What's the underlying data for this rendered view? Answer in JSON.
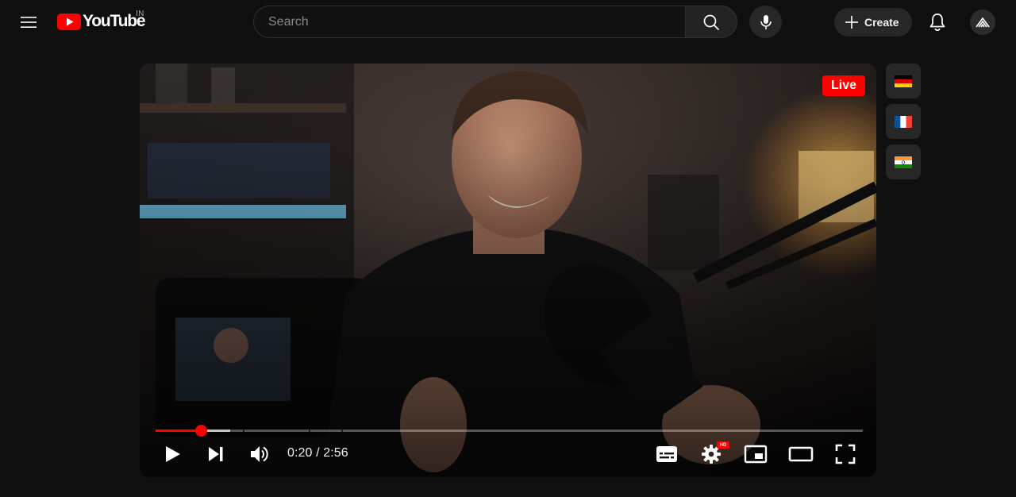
{
  "masthead": {
    "logo_text": "YouTube",
    "region_code": "IN",
    "search": {
      "placeholder": "Search",
      "value": ""
    },
    "create_label": "Create"
  },
  "player": {
    "live_label": "Live",
    "time": {
      "current": "0:20",
      "separator": " / ",
      "duration": "2:56"
    },
    "progress": {
      "played_fraction": 0.064,
      "buffered_fraction": 0.105,
      "chapter_marks": [
        0.123,
        0.217,
        0.263
      ]
    },
    "hd_label": "HD"
  },
  "languages": [
    {
      "icon": "germany-flag-icon",
      "colors": [
        "#000000",
        "#dd0000",
        "#ffce00"
      ]
    },
    {
      "icon": "france-flag-icon",
      "colors": [
        "#0055a4",
        "#ffffff",
        "#ef4135"
      ]
    },
    {
      "icon": "india-flag-icon",
      "colors": [
        "#ff9933",
        "#ffffff",
        "#138808"
      ]
    }
  ],
  "colors": {
    "brand_red": "#ff0000",
    "background": "#0f0f0f",
    "surface": "#272727"
  }
}
